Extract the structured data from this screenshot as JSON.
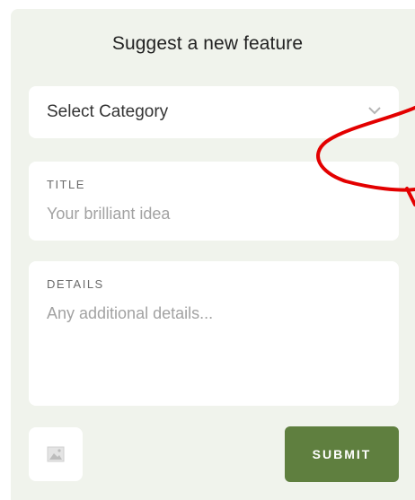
{
  "header": {
    "title": "Suggest a new feature"
  },
  "category_select": {
    "selected": "Select Category",
    "icon": "chevron-down-icon"
  },
  "title_field": {
    "label": "TITLE",
    "placeholder": "Your brilliant idea"
  },
  "details_field": {
    "label": "DETAILS",
    "placeholder": "Any additional details..."
  },
  "actions": {
    "image_icon": "image-icon",
    "submit_label": "SUBMIT"
  },
  "colors": {
    "panel_bg": "#f0f3ec",
    "submit_bg": "#5f7f3f",
    "annotation": "#e30000"
  }
}
